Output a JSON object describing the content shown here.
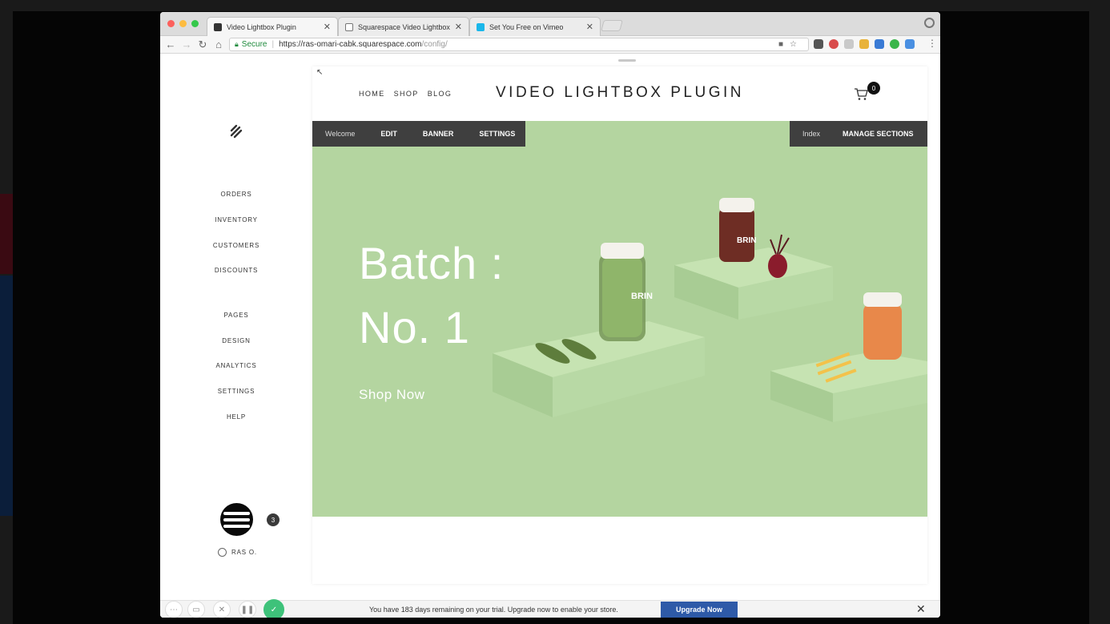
{
  "browser": {
    "tabs": [
      {
        "title": "Video Lightbox Plugin",
        "active": true,
        "icon": "squarespace-favicon"
      },
      {
        "title": "Squarespace Video Lightbox",
        "active": false,
        "icon": "document-icon"
      },
      {
        "title": "Set You Free on Vimeo",
        "active": false,
        "icon": "vimeo-favicon"
      }
    ],
    "secure_label": "Secure",
    "url_host": "https://ras-omari-cabk.squarespace.com",
    "url_path": "/config/"
  },
  "sidebar": {
    "commerce_items": [
      "ORDERS",
      "INVENTORY",
      "CUSTOMERS",
      "DISCOUNTS"
    ],
    "site_items": [
      "PAGES",
      "DESIGN",
      "ANALYTICS",
      "SETTINGS",
      "HELP"
    ],
    "notification_count": "3",
    "user_name": "RAS O."
  },
  "site": {
    "nav": [
      "HOME",
      "SHOP",
      "BLOG"
    ],
    "title": "VIDEO LIGHTBOX PLUGIN",
    "cart_count": "0",
    "edit_bar": {
      "welcome": "Welcome",
      "edit": "EDIT",
      "banner": "BANNER",
      "settings": "SETTINGS",
      "index": "Index",
      "manage_sections": "MANAGE SECTIONS"
    },
    "hero": {
      "heading_line1": "Batch :",
      "heading_line2": "No. 1",
      "cta": "Shop Now",
      "jar_label": "BRIN",
      "background_color": "#b4d5a0"
    }
  },
  "upgrade_bar": {
    "message": "You have 183 days remaining on your trial. Upgrade now to enable your store.",
    "button": "Upgrade Now"
  },
  "colors": {
    "accent_blue": "#2e5aa8",
    "confirm_green": "#3ec27a",
    "edit_bar": "#3f3f3f"
  }
}
